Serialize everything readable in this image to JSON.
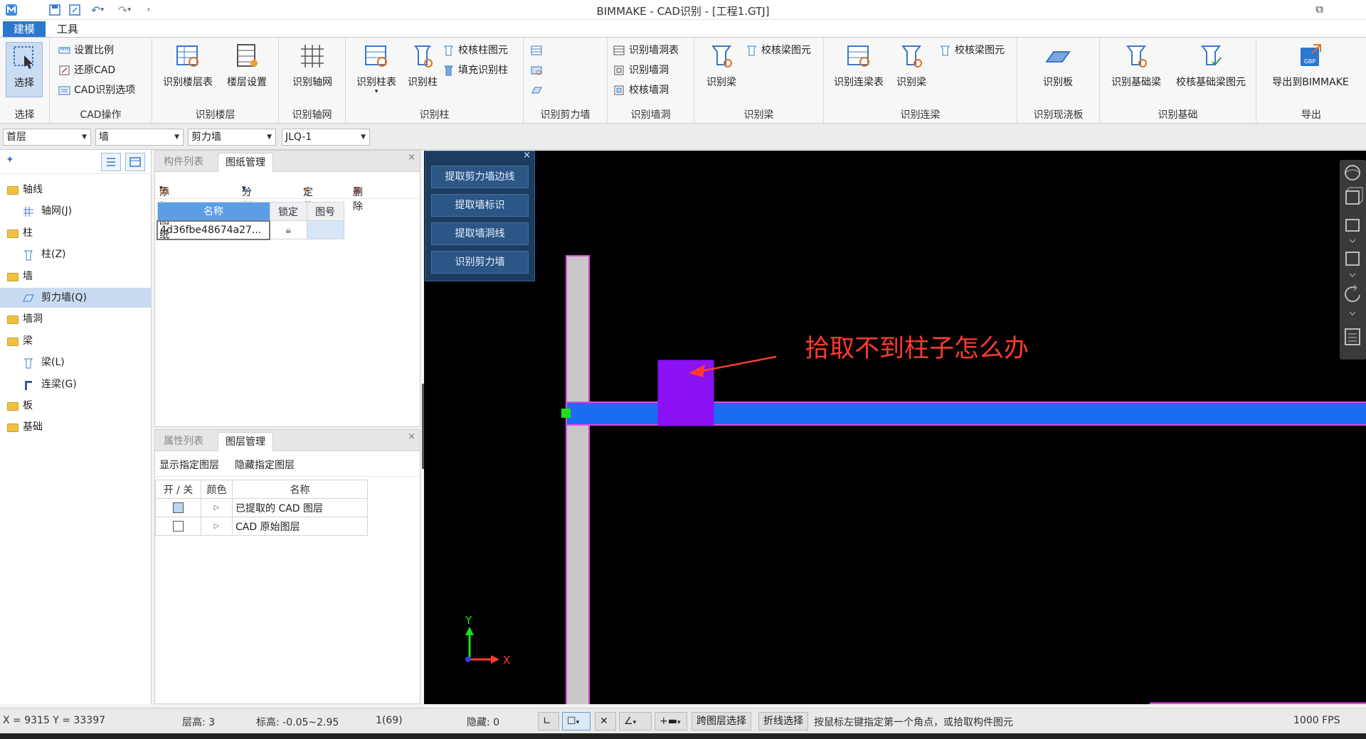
{
  "app": {
    "title": "BIMMAKE - CAD识别 - [工程1.GTJ]",
    "restore_glyph": "⧉"
  },
  "menu": {
    "tabs": [
      {
        "label": "建模"
      },
      {
        "label": "工具"
      }
    ]
  },
  "ribbon": {
    "select": {
      "button": "选择",
      "group": "选择"
    },
    "cad": {
      "items": [
        "设置比例",
        "还原CAD",
        "CAD识别选项"
      ],
      "group": "CAD操作"
    },
    "floors": {
      "items": [
        "识别楼层表",
        "楼层设置"
      ],
      "group": "识别楼层"
    },
    "axis": {
      "items": [
        "识别轴网"
      ],
      "group": "识别轴网"
    },
    "column": {
      "big": [
        "识别柱表",
        "识别柱"
      ],
      "small": [
        "校核柱图元",
        "填充识别柱"
      ],
      "group": "识别柱"
    },
    "shearwall": {
      "group": "识别剪力墙"
    },
    "wallhole": {
      "items": [
        "识别墙洞表",
        "识别墙洞",
        "校核墙洞"
      ],
      "group": "识别墙洞"
    },
    "beam": {
      "big": "识别梁",
      "small": "校核梁图元",
      "group": "识别梁"
    },
    "linkbeam": {
      "big": [
        "识别连梁表",
        "识别梁"
      ],
      "small": "校核梁图元",
      "group": "识别连梁"
    },
    "slab": {
      "big": "识别板",
      "group": "识别现浇板"
    },
    "foundation": {
      "big": [
        "识别基础梁",
        "校核基础梁图元"
      ],
      "group": "识别基础"
    },
    "export": {
      "big": "导出到BIMMAKE",
      "badge": "GBP",
      "group": "导出"
    }
  },
  "selectors": {
    "floor": "首层",
    "type": "墙",
    "subtype": "剪力墙",
    "component": "JLQ-1"
  },
  "tree": {
    "items": [
      {
        "label": "轴线",
        "level": 0,
        "icon": "folder-icon"
      },
      {
        "label": "轴网(J)",
        "level": 1,
        "icon": "axis-grid-icon"
      },
      {
        "label": "柱",
        "level": 0,
        "icon": "folder-icon"
      },
      {
        "label": "柱(Z)",
        "level": 1,
        "icon": "column-icon"
      },
      {
        "label": "墙",
        "level": 0,
        "icon": "folder-icon"
      },
      {
        "label": "剪力墙(Q)",
        "level": 1,
        "icon": "wall-icon",
        "selected": true
      },
      {
        "label": "墙洞",
        "level": 0,
        "icon": "folder-icon"
      },
      {
        "label": "梁",
        "level": 0,
        "icon": "folder-icon"
      },
      {
        "label": "梁(L)",
        "level": 1,
        "icon": "beam-icon"
      },
      {
        "label": "连梁(G)",
        "level": 1,
        "icon": "link-beam-icon"
      },
      {
        "label": "板",
        "level": 0,
        "icon": "folder-icon"
      },
      {
        "label": "基础",
        "level": 0,
        "icon": "folder-icon"
      }
    ]
  },
  "drawing_panel": {
    "tabs": [
      "构件列表",
      "图纸管理"
    ],
    "toolbar": [
      "添加图纸",
      "分割",
      "定位",
      "删除"
    ],
    "headers": [
      "名称",
      "锁定",
      "图号"
    ],
    "rows": [
      {
        "name": "4d36fbe48674a27...",
        "locked_icon": "lock-icon",
        "number": ""
      }
    ]
  },
  "layer_panel": {
    "tabs": [
      "属性列表",
      "图层管理"
    ],
    "actions": [
      "显示指定图层",
      "隐藏指定图层"
    ],
    "headers": [
      "开 / 关",
      "颜色",
      "名称"
    ],
    "rows": [
      {
        "on": true,
        "name": "已提取的 CAD 图层"
      },
      {
        "on": false,
        "name": "CAD 原始图层"
      }
    ]
  },
  "command_panel": {
    "buttons": [
      "提取剪力墙边线",
      "提取墙标识",
      "提取墙洞线",
      "识别剪力墙"
    ]
  },
  "canvas": {
    "annotation": "拾取不到柱子怎么办",
    "axis_y": "Y",
    "axis_x": "X",
    "colors": {
      "wall_h": "#1a6cf0",
      "wall_v": "#c8c8c8",
      "column": "#8a12f5",
      "annotation": "#ff3b30",
      "outline": "#e24ae6",
      "endpoint": "#19e219"
    }
  },
  "status": {
    "coords": "X = 9315 Y = 33397",
    "floor_height": "层高:  3",
    "elevation": "标高:  -0.05~2.95",
    "count": "1(69)",
    "hidden": "隐藏:  0",
    "cross_layer": "跨图层选择",
    "polyline": "折线选择",
    "hint": "按鼠标左键指定第一个角点，或拾取构件图元",
    "fps": "1000 FPS"
  }
}
